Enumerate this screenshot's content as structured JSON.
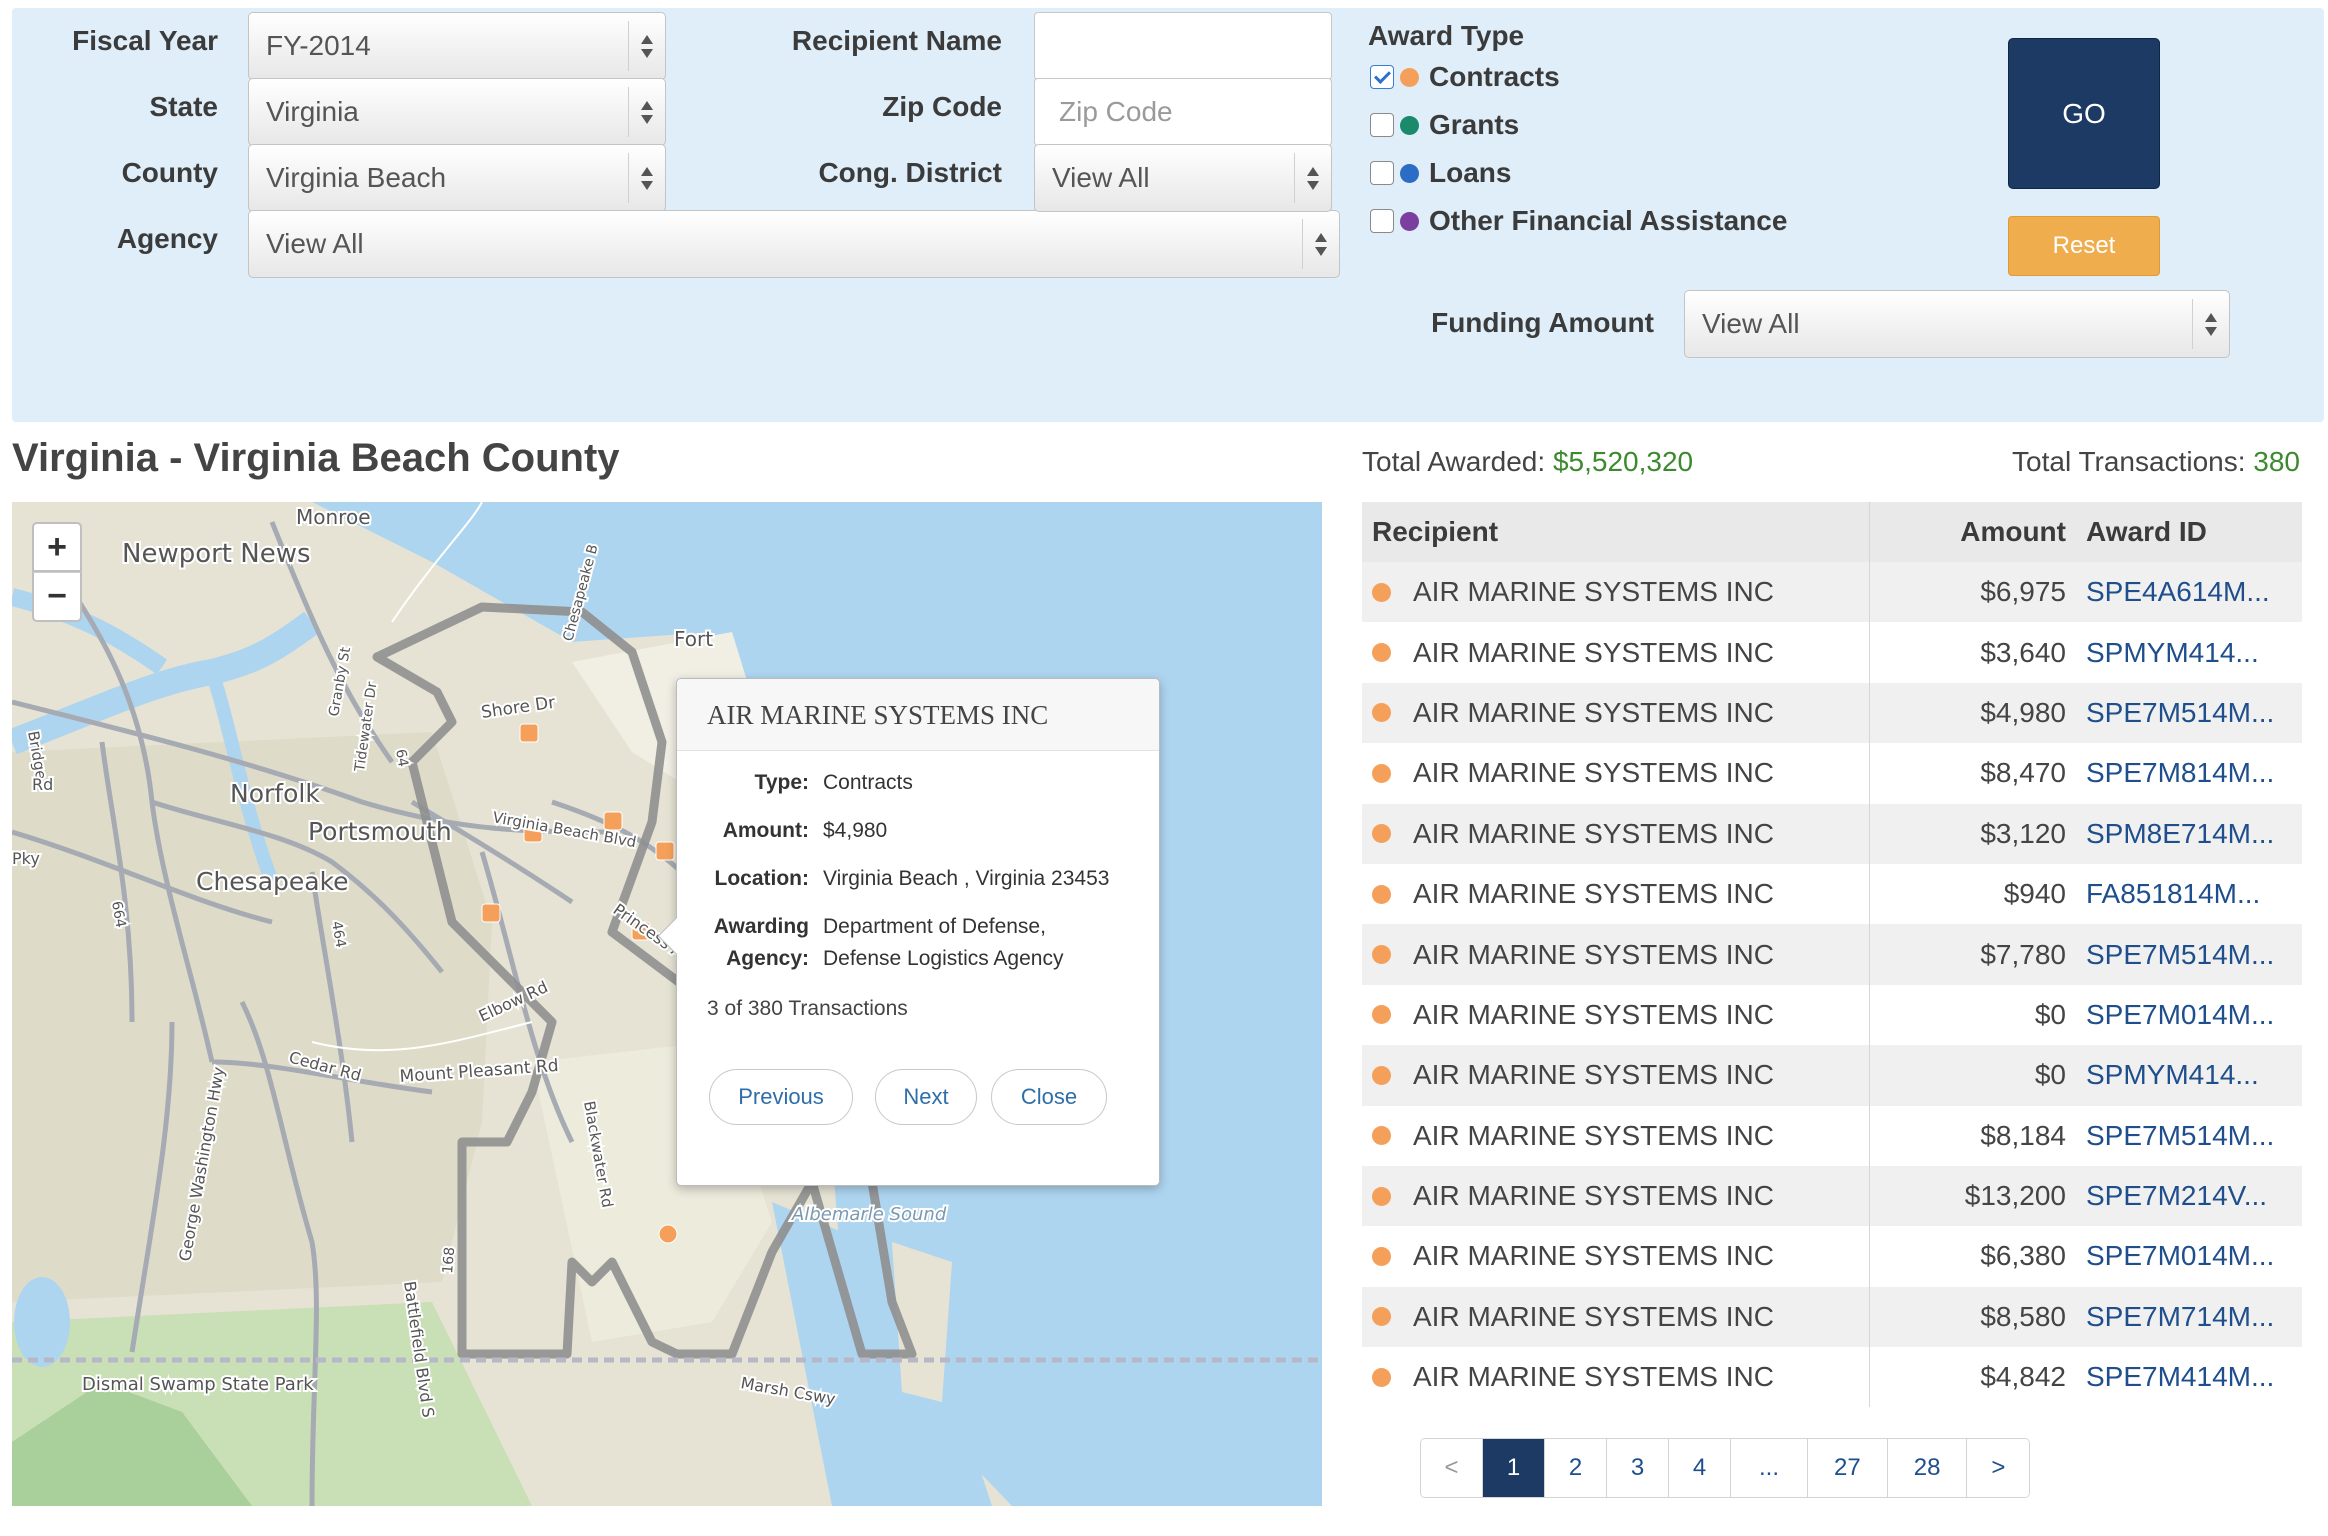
{
  "filters": {
    "fiscal_year": {
      "label": "Fiscal Year",
      "value": "FY-2014"
    },
    "state": {
      "label": "State",
      "value": "Virginia"
    },
    "county": {
      "label": "County",
      "value": "Virginia Beach"
    },
    "agency": {
      "label": "Agency",
      "value": "View All"
    },
    "recipient_name": {
      "label": "Recipient Name",
      "value": "",
      "placeholder": ""
    },
    "zip_code": {
      "label": "Zip Code",
      "value": "",
      "placeholder": "Zip Code"
    },
    "cong_district": {
      "label": "Cong. District",
      "value": "View All"
    },
    "award_type": {
      "title": "Award Type",
      "options": [
        {
          "label": "Contracts",
          "checked": true,
          "color": "#f5a05a"
        },
        {
          "label": "Grants",
          "checked": false,
          "color": "#1a8a6b"
        },
        {
          "label": "Loans",
          "checked": false,
          "color": "#2b6cc4"
        },
        {
          "label": "Other Financial Assistance",
          "checked": false,
          "color": "#7b3fa0"
        }
      ]
    },
    "funding_amount": {
      "label": "Funding Amount",
      "value": "View All"
    },
    "go_label": "GO",
    "reset_label": "Reset"
  },
  "summary": {
    "title": "Virginia - Virginia Beach County",
    "total_awarded_label": "Total Awarded:",
    "total_awarded_value": "$5,520,320",
    "total_transactions_label": "Total Transactions:",
    "total_transactions_value": "380"
  },
  "map": {
    "zoom_in": "+",
    "zoom_out": "−",
    "place_labels": [
      "Newport News",
      "Monroe",
      "Norfolk",
      "Portsmouth",
      "Chesapeake",
      "Fort",
      "Shore Dr",
      "Virginia Beach Blvd",
      "Princess Anne Rd",
      "Elbow Rd",
      "Cedar Rd",
      "Mount Pleasant Rd",
      "George Washington Hwy",
      "Battlefield Blvd S",
      "Blackwater Rd",
      "Albemarle Sound",
      "Marsh Cswy",
      "Dismal Swamp State Park",
      "Chesapeake B",
      "Tidewater Dr",
      "Granby St",
      "Bridge",
      "Rd",
      "Pky",
      "64",
      "464",
      "664",
      "168"
    ],
    "popup": {
      "title": "AIR MARINE SYSTEMS INC",
      "type_label": "Type:",
      "type_value": "Contracts",
      "amount_label": "Amount:",
      "amount_value": "$4,980",
      "location_label": "Location:",
      "location_value": "Virginia Beach , Virginia 23453",
      "agency_label_1": "Awarding",
      "agency_label_2": "Agency:",
      "agency_value_1": "Department of Defense,",
      "agency_value_2": "Defense Logistics Agency",
      "count_text": "3 of 380 Transactions",
      "previous": "Previous",
      "next": "Next",
      "close": "Close"
    }
  },
  "table": {
    "headers": {
      "recipient": "Recipient",
      "amount": "Amount",
      "award_id": "Award ID"
    },
    "rows": [
      {
        "recipient": "AIR MARINE SYSTEMS INC",
        "amount": "$6,975",
        "award_id": "SPE4A614M..."
      },
      {
        "recipient": "AIR MARINE SYSTEMS INC",
        "amount": "$3,640",
        "award_id": "SPMYM414..."
      },
      {
        "recipient": "AIR MARINE SYSTEMS INC",
        "amount": "$4,980",
        "award_id": "SPE7M514M..."
      },
      {
        "recipient": "AIR MARINE SYSTEMS INC",
        "amount": "$8,470",
        "award_id": "SPE7M814M..."
      },
      {
        "recipient": "AIR MARINE SYSTEMS INC",
        "amount": "$3,120",
        "award_id": "SPM8E714M..."
      },
      {
        "recipient": "AIR MARINE SYSTEMS INC",
        "amount": "$940",
        "award_id": "FA851814M..."
      },
      {
        "recipient": "AIR MARINE SYSTEMS INC",
        "amount": "$7,780",
        "award_id": "SPE7M514M..."
      },
      {
        "recipient": "AIR MARINE SYSTEMS INC",
        "amount": "$0",
        "award_id": "SPE7M014M..."
      },
      {
        "recipient": "AIR MARINE SYSTEMS INC",
        "amount": "$0",
        "award_id": "SPMYM414..."
      },
      {
        "recipient": "AIR MARINE SYSTEMS INC",
        "amount": "$8,184",
        "award_id": "SPE7M514M..."
      },
      {
        "recipient": "AIR MARINE SYSTEMS INC",
        "amount": "$13,200",
        "award_id": "SPE7M214V..."
      },
      {
        "recipient": "AIR MARINE SYSTEMS INC",
        "amount": "$6,380",
        "award_id": "SPE7M014M..."
      },
      {
        "recipient": "AIR MARINE SYSTEMS INC",
        "amount": "$8,580",
        "award_id": "SPE7M714M..."
      },
      {
        "recipient": "AIR MARINE SYSTEMS INC",
        "amount": "$4,842",
        "award_id": "SPE7M414M..."
      }
    ]
  },
  "pagination": {
    "prev": "<",
    "pages": [
      "1",
      "2",
      "3",
      "4",
      "...",
      "27",
      "28"
    ],
    "active": "1",
    "next": ">"
  },
  "colors": {
    "panel_bg": "#dfeef8",
    "go_button": "#1c3a63",
    "reset_button": "#f0ad4e",
    "contract_marker": "#f5a05a",
    "total_green": "#3c8a2e",
    "link_blue": "#1f4e8c"
  }
}
